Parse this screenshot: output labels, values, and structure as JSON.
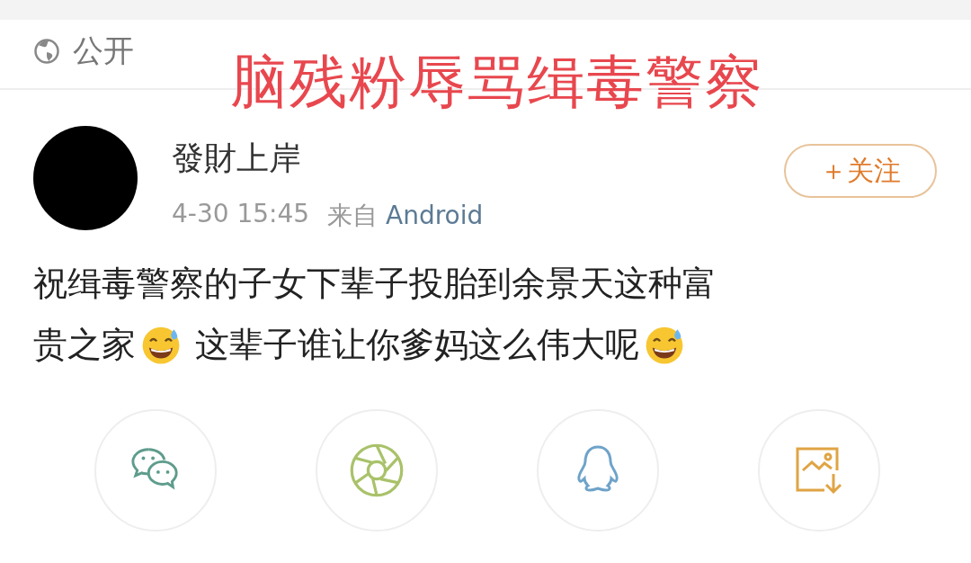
{
  "visibility": {
    "label": "公开"
  },
  "caption": "脑残粉辱骂缉毒警察",
  "post": {
    "author": "發財上岸",
    "time": "4-30 15:45",
    "source_prefix": "来自",
    "source": "Android",
    "follow_button": "＋关注",
    "body": [
      [
        {
          "kind": "text",
          "text": "祝缉毒警察的子女下辈子投胎到余景天这种富"
        }
      ],
      [
        {
          "kind": "text",
          "text": "贵之家"
        },
        {
          "kind": "emoji"
        },
        {
          "kind": "text",
          "text": "这辈子谁让你爹妈这么伟大呢"
        },
        {
          "kind": "emoji"
        }
      ]
    ]
  },
  "share_buttons": [
    {
      "kind": "wechat"
    },
    {
      "kind": "moments"
    },
    {
      "kind": "qq"
    },
    {
      "kind": "save-image"
    }
  ]
}
